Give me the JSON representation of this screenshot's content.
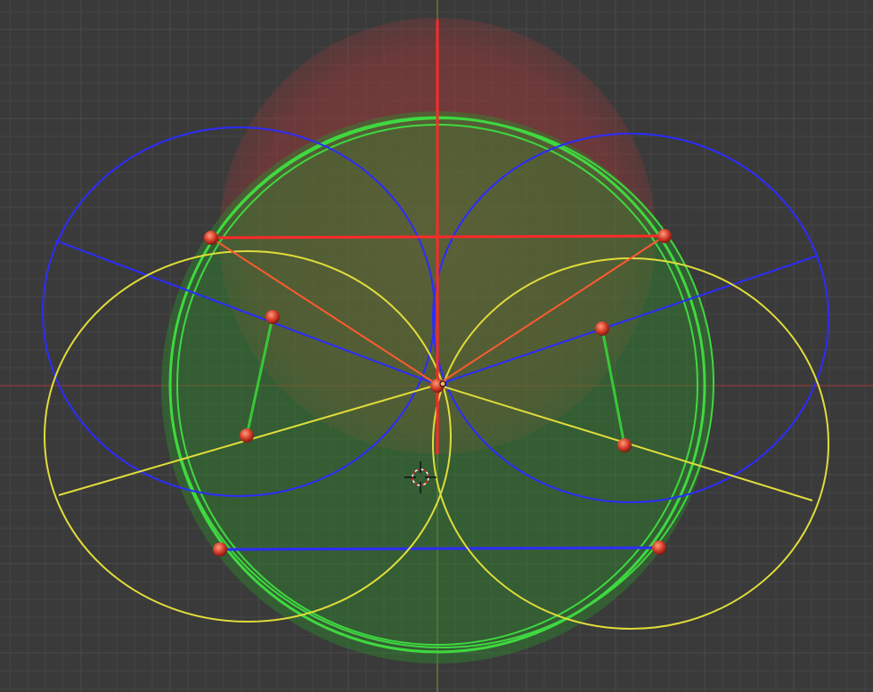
{
  "viewport": {
    "background": "#3a3a3a",
    "grid_minor_color": "#444444",
    "grid_major_color": "#4b4b4b",
    "axis_x_color": "#a33a3a",
    "axis_y_color": "#7d9a2e"
  },
  "colors": {
    "green_wire": "#3fd93f",
    "blue_wire": "#2c2cff",
    "yellow_wire": "#e0dc3a",
    "red_wire": "#ff2a2a",
    "orange_wire": "#ff5a30",
    "green_link": "#38c838",
    "joint": "#d23a28",
    "red_sphere": "#c03535",
    "green_sphere": "#2e7d2e"
  },
  "icons": {
    "cursor": "3d-cursor-crosshair-icon",
    "joint": "sphere-joint-icon",
    "origin": "object-origin-icon"
  }
}
